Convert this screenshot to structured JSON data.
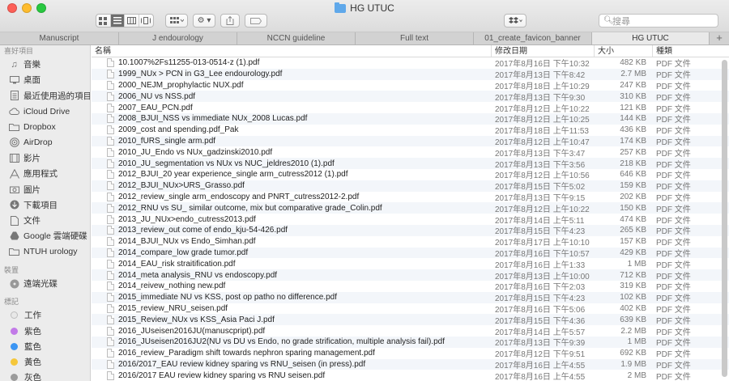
{
  "window": {
    "title": "HG UTUC"
  },
  "toolbar": {
    "search_placeholder": "搜尋",
    "view_modes": [
      "icon-view",
      "list-view",
      "column-view",
      "cover-flow-view"
    ],
    "active_view": "list-view"
  },
  "tabs": [
    {
      "label": "Manuscript"
    },
    {
      "label": "J endourology"
    },
    {
      "label": "NCCN guideline"
    },
    {
      "label": "Full text"
    },
    {
      "label": "01_create_favicon_banner"
    },
    {
      "label": "HG UTUC"
    }
  ],
  "sidebar": {
    "favorites_label": "喜好項目",
    "favorites": [
      {
        "label": "音樂",
        "icon": "music-note-icon"
      },
      {
        "label": "桌面",
        "icon": "desktop-icon"
      },
      {
        "label": "最近使用過的項目",
        "icon": "recents-icon"
      },
      {
        "label": "iCloud Drive",
        "icon": "cloud-icon"
      },
      {
        "label": "Dropbox",
        "icon": "folder-icon"
      },
      {
        "label": "AirDrop",
        "icon": "airdrop-icon"
      },
      {
        "label": "影片",
        "icon": "film-icon"
      },
      {
        "label": "應用程式",
        "icon": "applications-icon"
      },
      {
        "label": "圖片",
        "icon": "camera-icon"
      },
      {
        "label": "下載項目",
        "icon": "download-icon"
      },
      {
        "label": "文件",
        "icon": "document-icon"
      },
      {
        "label": "Google 雲端硬碟",
        "icon": "google-drive-icon"
      },
      {
        "label": "NTUH urology",
        "icon": "folder-icon"
      }
    ],
    "devices_label": "裝置",
    "devices": [
      {
        "label": "遠端光碟",
        "icon": "optical-disc-icon"
      }
    ],
    "tags_label": "標記",
    "tags": [
      {
        "label": "工作",
        "color": "#e8e8e8"
      },
      {
        "label": "紫色",
        "color": "#c27ae8"
      },
      {
        "label": "藍色",
        "color": "#3b95f3"
      },
      {
        "label": "黃色",
        "color": "#f5c73b"
      },
      {
        "label": "灰色",
        "color": "#9b9b9b"
      }
    ]
  },
  "file_list": {
    "columns": {
      "name": "名稱",
      "date": "修改日期",
      "size": "大小",
      "kind": "種類"
    },
    "rows": [
      {
        "name": "10.1007%2Fs11255-013-0514-z (1).pdf",
        "date": "2017年8月16日 下午10:32",
        "size": "482 KB",
        "kind": "PDF 文件"
      },
      {
        "name": "1999_NUx > PCN in G3_Lee endourology.pdf",
        "date": "2017年8月13日 下午8:42",
        "size": "2.7 MB",
        "kind": "PDF 文件"
      },
      {
        "name": "2000_NEJM_prophylactic NUX.pdf",
        "date": "2017年8月18日 上午10:29",
        "size": "247 KB",
        "kind": "PDF 文件"
      },
      {
        "name": "2006_NU vs NSS.pdf",
        "date": "2017年8月13日 下午9:30",
        "size": "310 KB",
        "kind": "PDF 文件"
      },
      {
        "name": "2007_EAU_PCN.pdf",
        "date": "2017年8月12日 上午10:22",
        "size": "121 KB",
        "kind": "PDF 文件"
      },
      {
        "name": "2008_BJUI_NSS vs immediate NUx_2008 Lucas.pdf",
        "date": "2017年8月12日 上午10:25",
        "size": "144 KB",
        "kind": "PDF 文件"
      },
      {
        "name": "2009_cost and spending.pdf_Pak",
        "date": "2017年8月18日 上午11:53",
        "size": "436 KB",
        "kind": "PDF 文件"
      },
      {
        "name": "2010_fURS_single arm.pdf",
        "date": "2017年8月12日 上午10:47",
        "size": "174 KB",
        "kind": "PDF 文件"
      },
      {
        "name": "2010_JU_Endo vs NUx_gadzinski2010.pdf",
        "date": "2017年8月13日 下午3:47",
        "size": "257 KB",
        "kind": "PDF 文件"
      },
      {
        "name": "2010_JU_segmentation vs NUx vs NUC_jeldres2010 (1).pdf",
        "date": "2017年8月13日 下午3:56",
        "size": "218 KB",
        "kind": "PDF 文件"
      },
      {
        "name": "2012_BJUI_20 year experience_single arm_cutress2012 (1).pdf",
        "date": "2017年8月12日 上午10:56",
        "size": "646 KB",
        "kind": "PDF 文件"
      },
      {
        "name": "2012_BJUI_NUx>URS_Grasso.pdf",
        "date": "2017年8月15日 下午5:02",
        "size": "159 KB",
        "kind": "PDF 文件"
      },
      {
        "name": "2012_review_single arm_endoscopy and PNRT_cutress2012-2.pdf",
        "date": "2017年8月13日 下午9:15",
        "size": "202 KB",
        "kind": "PDF 文件"
      },
      {
        "name": "2012_RNU vs SU_ similar outcome, mix but comparative grade_Colin.pdf",
        "date": "2017年8月12日 上午10:22",
        "size": "150 KB",
        "kind": "PDF 文件"
      },
      {
        "name": "2013_JU_NUx>endo_cutress2013.pdf",
        "date": "2017年8月14日 上午5:11",
        "size": "474 KB",
        "kind": "PDF 文件"
      },
      {
        "name": "2013_review_out come of endo_kju-54-426.pdf",
        "date": "2017年8月15日 下午4:23",
        "size": "265 KB",
        "kind": "PDF 文件"
      },
      {
        "name": "2014_BJUI_NUx vs Endo_Simhan.pdf",
        "date": "2017年8月17日 上午10:10",
        "size": "157 KB",
        "kind": "PDF 文件"
      },
      {
        "name": "2014_compare_low grade tumor.pdf",
        "date": "2017年8月16日 下午10:57",
        "size": "429 KB",
        "kind": "PDF 文件"
      },
      {
        "name": "2014_EAU_risk straitification.pdf",
        "date": "2017年8月16日 上午1:33",
        "size": "1 MB",
        "kind": "PDF 文件"
      },
      {
        "name": "2014_meta analysis_RNU vs endoscopy.pdf",
        "date": "2017年8月13日 上午10:00",
        "size": "712 KB",
        "kind": "PDF 文件"
      },
      {
        "name": "2014_reivew_nothing new.pdf",
        "date": "2017年8月16日 下午2:03",
        "size": "319 KB",
        "kind": "PDF 文件"
      },
      {
        "name": "2015_immediate NU vs KSS, post op patho no difference.pdf",
        "date": "2017年8月15日 下午4:23",
        "size": "102 KB",
        "kind": "PDF 文件"
      },
      {
        "name": "2015_review_NRU_seisen.pdf",
        "date": "2017年8月16日 下午5:06",
        "size": "402 KB",
        "kind": "PDF 文件"
      },
      {
        "name": "2015_Review_NUx vs KSS_Asia Paci J.pdf",
        "date": "2017年8月15日 下午4:36",
        "size": "639 KB",
        "kind": "PDF 文件"
      },
      {
        "name": "2016_JUseisen2016JU(manuscpript).pdf",
        "date": "2017年8月14日 上午5:57",
        "size": "2.2 MB",
        "kind": "PDF 文件"
      },
      {
        "name": "2016_JUseisen2016JU2(NU vs DU vs Endo, no grade strification, multiple analysis fail).pdf",
        "date": "2017年8月13日 下午9:39",
        "size": "1 MB",
        "kind": "PDF 文件"
      },
      {
        "name": "2016_review_Paradigm shift towards nephron sparing management.pdf",
        "date": "2017年8月12日 下午9:51",
        "size": "692 KB",
        "kind": "PDF 文件"
      },
      {
        "name": "2016/2017_EAU review kidney sparing vs RNU_seisen (in press).pdf",
        "date": "2017年8月16日 上午4:55",
        "size": "1.9 MB",
        "kind": "PDF 文件"
      },
      {
        "name": "2016/2017 EAU review kidney sparing vs RNU seisen.pdf",
        "date": "2017年8月16日 上午4:55",
        "size": "2 MB",
        "kind": "PDF 文件"
      }
    ]
  }
}
